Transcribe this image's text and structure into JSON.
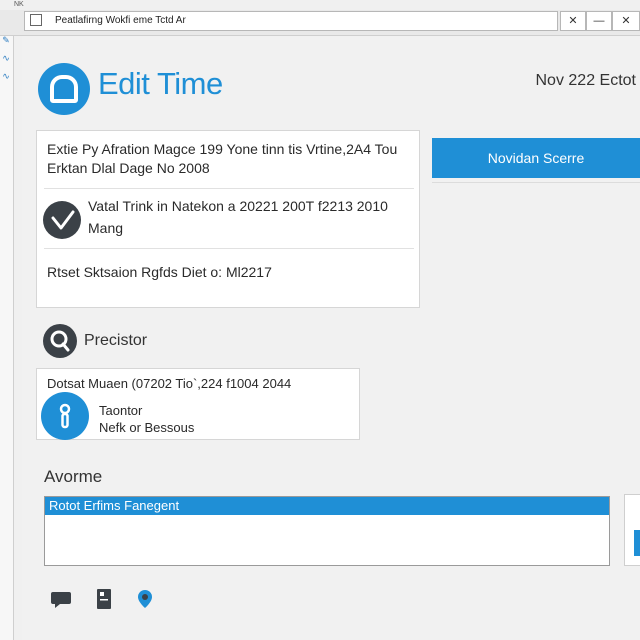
{
  "window": {
    "corner_mark": "NK",
    "address_text": "Peatlafirng Wokfi eme Tctd Ar",
    "controls": [
      "—",
      "✕",
      "⤢",
      "✕"
    ]
  },
  "header": {
    "title": "Edit Time",
    "date": "Nov 222 Ectot"
  },
  "details_card": {
    "row1_line1": "Extie Py Afration Magce 199 Yone tinn tis Vrtine,2A4 Tou",
    "row1_line2": "Erktan Dlal Dage No 2008",
    "row2_line1": "Vatal Trink in Natekon a 20221 200T f2213 2010",
    "row2_line2": "Mang",
    "row3": "Rtset Sktsaion Rgfds Diet o: Ml2217"
  },
  "action_button": {
    "label": "Novidan Scerre"
  },
  "preceptor": {
    "label": "Precistor"
  },
  "summary_card": {
    "line1": "Dotsat Muaen (07202 Tio`,224 f1004 2044",
    "line2": "Taontor",
    "line3": "Nefk or Bessous"
  },
  "form": {
    "section_label": "Avorme",
    "field_header": "Rotot Erfims Fanegent"
  },
  "colors": {
    "accent": "#1f8fd6",
    "dark_icon": "#3b4147"
  },
  "icons": [
    "chat-icon",
    "document-icon",
    "location-icon",
    "check-icon",
    "search-icon",
    "info-icon",
    "logo-icon"
  ]
}
